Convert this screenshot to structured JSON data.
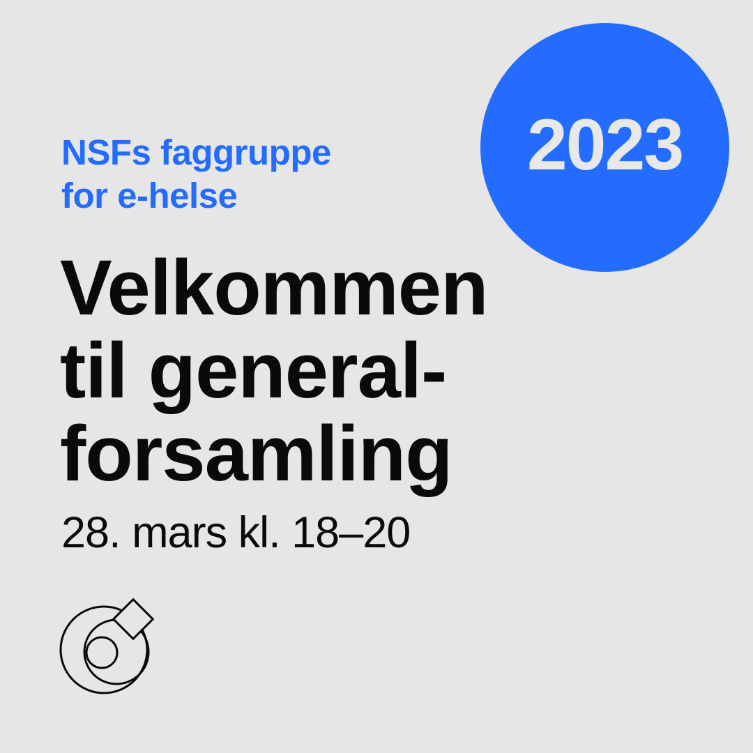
{
  "badge": {
    "year": "2023",
    "color": "#236cff"
  },
  "organization": {
    "line1": "NSFs faggruppe",
    "line2": "for e-helse",
    "color": "#236cff"
  },
  "headline": {
    "line1": "Velkommen",
    "line2": "til general-",
    "line3": "forsamling"
  },
  "event_date": "28. mars kl. 18–20",
  "logo": {
    "icon": "nsf-logo-icon"
  },
  "background_color": "#e6e6e6"
}
